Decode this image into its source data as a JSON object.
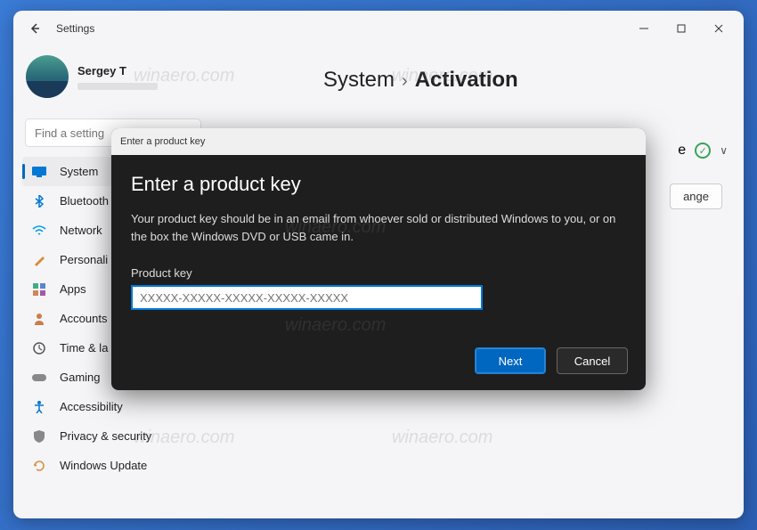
{
  "window": {
    "title": "Settings"
  },
  "user": {
    "name": "Sergey T"
  },
  "search": {
    "placeholder": "Find a setting"
  },
  "sidebar": {
    "items": [
      {
        "label": "System"
      },
      {
        "label": "Bluetooth"
      },
      {
        "label": "Network"
      },
      {
        "label": "Personali"
      },
      {
        "label": "Apps"
      },
      {
        "label": "Accounts"
      },
      {
        "label": "Time & la"
      },
      {
        "label": "Gaming"
      },
      {
        "label": "Accessibility"
      },
      {
        "label": "Privacy & security"
      },
      {
        "label": "Windows Update"
      }
    ]
  },
  "breadcrumb": {
    "parent": "System",
    "sep": "›",
    "current": "Activation"
  },
  "content": {
    "status_text": "e",
    "change_label": "ange"
  },
  "dialog": {
    "titlebar": "Enter a product key",
    "heading": "Enter a product key",
    "description": "Your product key should be in an email from whoever sold or distributed Windows to you, or on the box the Windows DVD or USB came in.",
    "input_label": "Product key",
    "input_placeholder": "XXXXX-XXXXX-XXXXX-XXXXX-XXXXX",
    "next_label": "Next",
    "cancel_label": "Cancel"
  },
  "watermark": "winaero.com"
}
